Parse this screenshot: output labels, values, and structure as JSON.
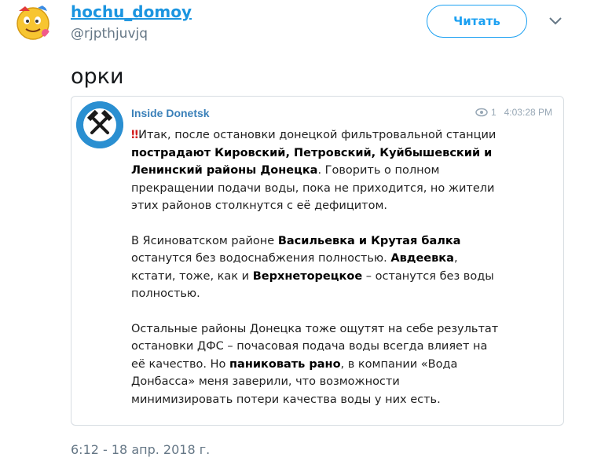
{
  "author": {
    "display_name": "hochu_domoy",
    "handle": "@rjpthjuvjq",
    "avatar_icon": "emoji-face-icon"
  },
  "follow_button": {
    "label": "Читать"
  },
  "tweet": {
    "text": "орки",
    "timestamp": "6:12 - 18 апр. 2018 г."
  },
  "embedded": {
    "channel_name": "Inside Donetsk",
    "views": "1",
    "time": "4:03:28 PM",
    "exclamation": "‼️",
    "paragraphs": [
      [
        {
          "t": "‼",
          "s": "bang"
        },
        {
          "t": "Итак, после остановки донецкой фильтровальной станции ",
          "s": "n"
        },
        {
          "t": "пострадают Кировский, Петровский, Куйбышевский и Ленинский районы Донецка",
          "s": "b"
        },
        {
          "t": ". Говорить о полном прекращении подачи воды, пока не приходится, но жители этих районов столкнутся с её дефицитом.",
          "s": "n"
        }
      ],
      [
        {
          "t": "В Ясиноватском районе ",
          "s": "n"
        },
        {
          "t": "Васильевка и Крутая балка",
          "s": "b"
        },
        {
          "t": " останутся без водоснабжения полностью. ",
          "s": "n"
        },
        {
          "t": "Авдеевка",
          "s": "b"
        },
        {
          "t": ", кстати, тоже, как и ",
          "s": "n"
        },
        {
          "t": "Верхнеторецкое",
          "s": "b"
        },
        {
          "t": " – останутся без воды полностью.",
          "s": "n"
        }
      ],
      [
        {
          "t": "Остальные районы Донецка тоже ощутят на себе результат остановки ДФС – почасовая подача воды всегда влияет на её качество. Но ",
          "s": "n"
        },
        {
          "t": "паниковать рано",
          "s": "b"
        },
        {
          "t": ", в компании «Вода Донбасса» меня заверили, что возможности минимизировать потери качества воды у них есть.",
          "s": "n"
        }
      ]
    ]
  },
  "colors": {
    "link": "#1b95e0",
    "follow": "#1da1f2",
    "channel": "#3a80b9",
    "muted": "#657786"
  }
}
